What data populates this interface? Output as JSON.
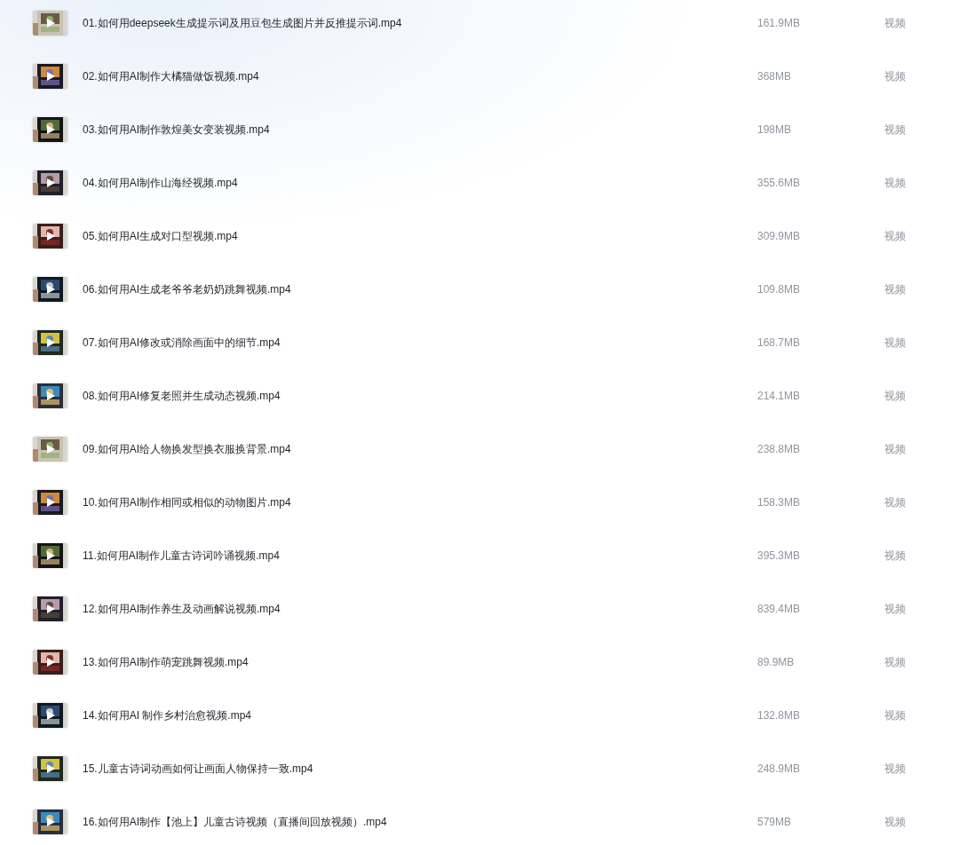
{
  "files": [
    {
      "name": "01.如何用deepseek生成提示词及用豆包生成图片并反推提示词.mp4",
      "size": "161.9MB",
      "type": "视频"
    },
    {
      "name": "02.如何用AI制作大橘猫做饭视频.mp4",
      "size": "368MB",
      "type": "视频"
    },
    {
      "name": "03.如何用AI制作敦煌美女变装视频.mp4",
      "size": "198MB",
      "type": "视频"
    },
    {
      "name": "04.如何用AI制作山海经视频.mp4",
      "size": "355.6MB",
      "type": "视频"
    },
    {
      "name": "05.如何用AI生成对口型视频.mp4",
      "size": "309.9MB",
      "type": "视频"
    },
    {
      "name": "06.如何用AI生成老爷爷老奶奶跳舞视频.mp4",
      "size": "109.8MB",
      "type": "视频"
    },
    {
      "name": "07.如何用AI修改或消除画面中的细节.mp4",
      "size": "168.7MB",
      "type": "视频"
    },
    {
      "name": "08.如何用AI修复老照并生成动态视频.mp4",
      "size": "214.1MB",
      "type": "视频"
    },
    {
      "name": "09.如何用AI给人物换发型换衣服换背景.mp4",
      "size": "238.8MB",
      "type": "视频"
    },
    {
      "name": "10.如何用AI制作相同或相似的动物图片.mp4",
      "size": "158.3MB",
      "type": "视频"
    },
    {
      "name": "11.如何用AI制作儿童古诗词吟诵视频.mp4",
      "size": "395.3MB",
      "type": "视频"
    },
    {
      "name": "12.如何用AI制作养生及动画解说视频.mp4",
      "size": "839.4MB",
      "type": "视频"
    },
    {
      "name": "13.如何用AI制作萌宠跳舞视频.mp4",
      "size": "89.9MB",
      "type": "视频"
    },
    {
      "name": "14.如何用AI 制作乡村治愈视频.mp4",
      "size": "132.8MB",
      "type": "视频"
    },
    {
      "name": "15.儿童古诗词动画如何让画面人物保持一致.mp4",
      "size": "248.9MB",
      "type": "视频"
    },
    {
      "name": "16.如何用AI制作【池上】儿童古诗视频（直播间回放视频）.mp4",
      "size": "579MB",
      "type": "视频"
    }
  ]
}
